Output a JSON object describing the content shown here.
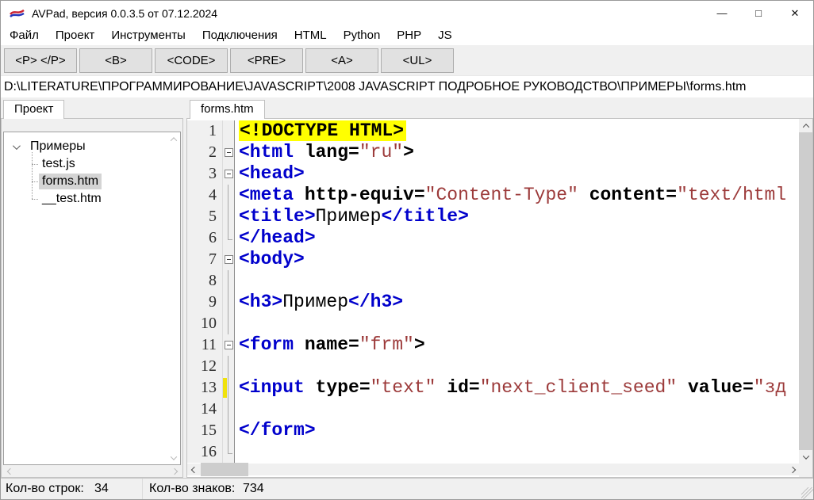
{
  "colors": {
    "syntax_tag": "#0000CC",
    "syntax_attr_name": "#000000",
    "syntax_attr_value": "#9C3A3A",
    "doctype_highlight_bg": "#FFFF00",
    "tree_selection_bg": "#D4D4D4",
    "modified_line_marker": "#F0E20C",
    "button_face": "#E1E1E1",
    "window_bg": "#F0F0F0"
  },
  "titlebar": {
    "title": "AVPad, версия 0.0.3.5 от 07.12.2024",
    "controls": {
      "minimize": "—",
      "maximize": "□",
      "close": "✕"
    }
  },
  "menubar": {
    "items": [
      "Файл",
      "Проект",
      "Инструменты",
      "Подключения",
      "HTML",
      "Python",
      "PHP",
      "JS"
    ]
  },
  "toolbar": {
    "buttons": [
      "<P> </P>",
      "<B>",
      "<CODE>",
      "<PRE>",
      "<A>",
      "<UL>"
    ]
  },
  "pathbar": {
    "path": "D:\\LITERATURE\\ПРОГРАММИРОВАНИЕ\\JAVASCRIPT\\2008 JAVASCRIPT ПОДРОБНОЕ РУКОВОДСТВО\\ПРИМЕРЫ\\forms.htm"
  },
  "project_panel": {
    "tab_label": "Проект",
    "tree": {
      "root_label": "Примеры",
      "items": [
        {
          "label": "test.js",
          "selected": false
        },
        {
          "label": "forms.htm",
          "selected": true
        },
        {
          "label": "__test.htm",
          "selected": false
        }
      ]
    }
  },
  "editor": {
    "tab_label": "forms.htm",
    "lines": [
      {
        "n": 1,
        "fold": "none",
        "marker": false,
        "tokens": [
          [
            "d",
            "<!DOCTYPE HTML>"
          ]
        ]
      },
      {
        "n": 2,
        "fold": "box",
        "marker": false,
        "tokens": [
          [
            "t",
            "<html"
          ],
          [
            "a",
            " lang="
          ],
          [
            "v",
            "\"ru\""
          ],
          [
            "a",
            ">"
          ]
        ]
      },
      {
        "n": 3,
        "fold": "box",
        "marker": false,
        "tokens": [
          [
            "t",
            "<head>"
          ]
        ]
      },
      {
        "n": 4,
        "fold": "line",
        "marker": false,
        "tokens": [
          [
            "t",
            "<meta"
          ],
          [
            "a",
            " http-equiv="
          ],
          [
            "v",
            "\"Content-Type\""
          ],
          [
            "a",
            " content="
          ],
          [
            "v",
            "\"text/html"
          ]
        ]
      },
      {
        "n": 5,
        "fold": "line",
        "marker": false,
        "tokens": [
          [
            "t",
            "<title>"
          ],
          [
            "x",
            "Пример"
          ],
          [
            "t",
            "</title>"
          ]
        ]
      },
      {
        "n": 6,
        "fold": "corner",
        "marker": false,
        "tokens": [
          [
            "t",
            "</head>"
          ]
        ]
      },
      {
        "n": 7,
        "fold": "box",
        "marker": false,
        "tokens": [
          [
            "t",
            "<body>"
          ]
        ]
      },
      {
        "n": 8,
        "fold": "line",
        "marker": false,
        "tokens": []
      },
      {
        "n": 9,
        "fold": "line",
        "marker": false,
        "tokens": [
          [
            "t",
            "<h3>"
          ],
          [
            "x",
            "Пример"
          ],
          [
            "t",
            "</h3>"
          ]
        ]
      },
      {
        "n": 10,
        "fold": "line",
        "marker": false,
        "tokens": []
      },
      {
        "n": 11,
        "fold": "box",
        "marker": false,
        "tokens": [
          [
            "t",
            "<form"
          ],
          [
            "a",
            " name="
          ],
          [
            "v",
            "\"frm\""
          ],
          [
            "a",
            ">"
          ]
        ]
      },
      {
        "n": 12,
        "fold": "line",
        "marker": false,
        "tokens": []
      },
      {
        "n": 13,
        "fold": "line",
        "marker": true,
        "tokens": [
          [
            "t",
            "<input"
          ],
          [
            "a",
            " type="
          ],
          [
            "v",
            "\"text\""
          ],
          [
            "a",
            " id="
          ],
          [
            "v",
            "\"next_client_seed\""
          ],
          [
            "a",
            " value="
          ],
          [
            "v",
            "\"зд"
          ]
        ]
      },
      {
        "n": 14,
        "fold": "line",
        "marker": false,
        "tokens": []
      },
      {
        "n": 15,
        "fold": "line",
        "marker": false,
        "tokens": [
          [
            "t",
            "</form>"
          ]
        ]
      },
      {
        "n": 16,
        "fold": "corner",
        "marker": false,
        "tokens": []
      }
    ]
  },
  "statusbar": {
    "lines_label": "Кол-во строк:",
    "lines_value": "34",
    "chars_label": "Кол-во знаков:",
    "chars_value": "734"
  }
}
